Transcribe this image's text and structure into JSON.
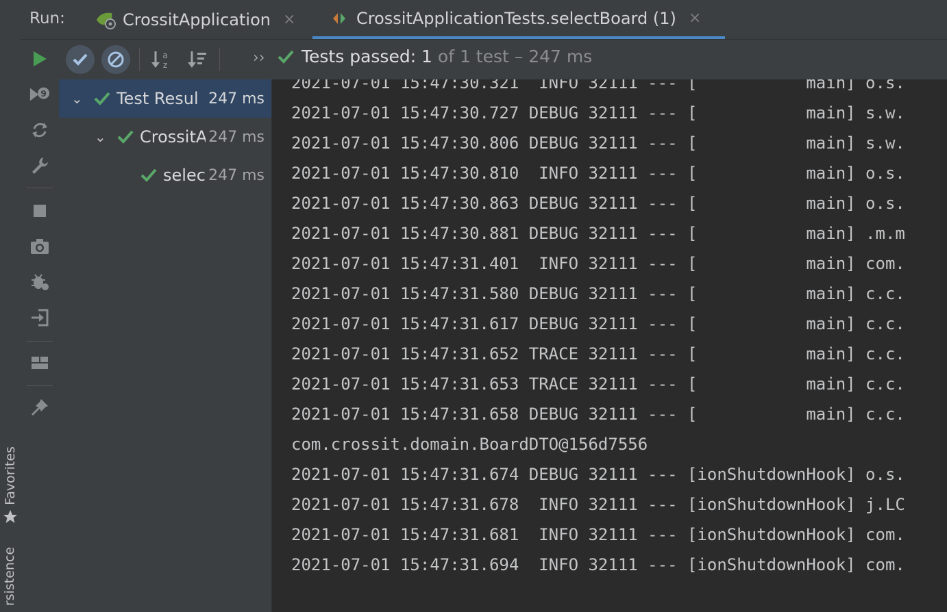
{
  "sidebar_tabs": {
    "favorites": "Favorites",
    "persistence": "rsistence"
  },
  "run_bar": {
    "label": "Run:",
    "tabs": [
      {
        "label": "CrossitApplication",
        "close": "×"
      },
      {
        "label": "CrossitApplicationTests.selectBoard (1)",
        "close": "×"
      }
    ]
  },
  "test_toolbar": {
    "more": "››",
    "status_strong": "Tests passed: 1",
    "status_rest": " of 1 test – 247 ms"
  },
  "tree": [
    {
      "chevron": "⌄",
      "name": "Test Resul",
      "time": "247 ms"
    },
    {
      "chevron": "⌄",
      "name": "CrossitA",
      "time": "247 ms"
    },
    {
      "chevron": "",
      "name": "selec",
      "time": "247 ms"
    }
  ],
  "console": [
    "2021-07-01 15:47:30.321  INFO 32111 --- [           main] o.s.",
    "2021-07-01 15:47:30.727 DEBUG 32111 --- [           main] s.w.",
    "2021-07-01 15:47:30.806 DEBUG 32111 --- [           main] s.w.",
    "2021-07-01 15:47:30.810  INFO 32111 --- [           main] o.s.",
    "2021-07-01 15:47:30.863 DEBUG 32111 --- [           main] o.s.",
    "2021-07-01 15:47:30.881 DEBUG 32111 --- [           main] .m.m",
    "2021-07-01 15:47:31.401  INFO 32111 --- [           main] com.",
    "2021-07-01 15:47:31.580 DEBUG 32111 --- [           main] c.c.",
    "2021-07-01 15:47:31.617 DEBUG 32111 --- [           main] c.c.",
    "2021-07-01 15:47:31.652 TRACE 32111 --- [           main] c.c.",
    "2021-07-01 15:47:31.653 TRACE 32111 --- [           main] c.c.",
    "2021-07-01 15:47:31.658 DEBUG 32111 --- [           main] c.c.",
    "com.crossit.domain.BoardDTO@156d7556",
    "2021-07-01 15:47:31.674 DEBUG 32111 --- [ionShutdownHook] o.s.",
    "2021-07-01 15:47:31.678  INFO 32111 --- [ionShutdownHook] j.LC",
    "2021-07-01 15:47:31.681  INFO 32111 --- [ionShutdownHook] com.",
    "2021-07-01 15:47:31.694  INFO 32111 --- [ionShutdownHook] com."
  ],
  "colors": {
    "accent_tab": "#4a88c7",
    "pass_green": "#59a869",
    "run_green": "#499c54",
    "selected_row": "#2f4562"
  }
}
